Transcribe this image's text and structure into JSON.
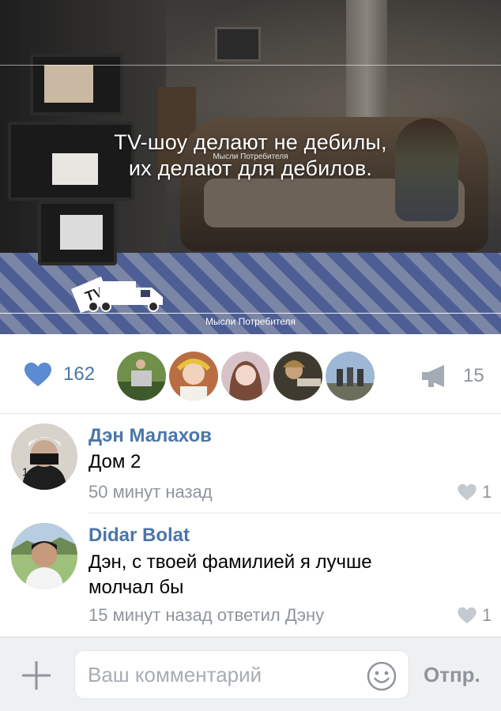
{
  "post": {
    "image": {
      "quote_line1": "TV-шоу делают не дебилы,",
      "quote_line2": "их делают для дебилов.",
      "watermark": "Мысли Потребителя",
      "caption": "Мысли Потребителя",
      "logo_text": "TV"
    }
  },
  "actions": {
    "like_icon": "heart-icon",
    "like_count": "162",
    "likers": [
      {
        "name": "liker-avatar-1",
        "color": "#5a7a3a"
      },
      {
        "name": "liker-avatar-2",
        "color": "#b5734a"
      },
      {
        "name": "liker-avatar-3",
        "color": "#d9b6b0"
      },
      {
        "name": "liker-avatar-4",
        "color": "#4b4436"
      },
      {
        "name": "liker-avatar-5",
        "color": "#7a94b5"
      }
    ],
    "share_icon": "megaphone-icon",
    "share_count": "15"
  },
  "comments": [
    {
      "author": "Дэн Малахов",
      "text": "Дом 2",
      "meta": "50 минут назад",
      "likes": "1"
    },
    {
      "author": "Didar Bolat",
      "text": "Дэн, с твоей фамилией я лучше молчал бы",
      "meta": "15 минут назад ответил Дэну",
      "likes": "1"
    }
  ],
  "composer": {
    "add_icon": "plus-icon",
    "placeholder": "Ваш комментарий",
    "smile_icon": "smile-icon",
    "send_label": "Отпр."
  },
  "colors": {
    "accent": "#4a76a8",
    "muted": "#8f959c",
    "like_heart": "#4a76a8"
  }
}
